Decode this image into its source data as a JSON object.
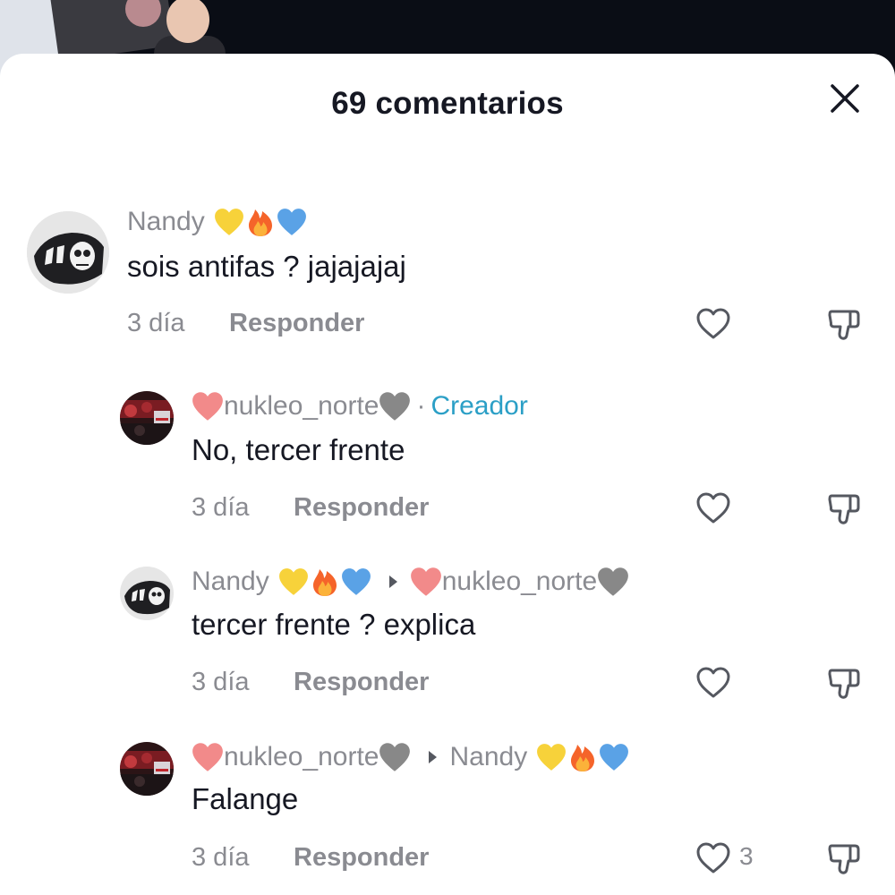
{
  "sheet": {
    "title": "69 comentarios"
  },
  "comments": [
    {
      "username": "Nandy",
      "emojis": [
        "yellow-heart",
        "fire",
        "blue-heart"
      ],
      "text": "sois antifas ? jajajajaj",
      "time": "3 día",
      "reply_label": "Responder"
    },
    {
      "username_prefix_emoji": "red-heart",
      "username": "nukleo_norte",
      "username_suffix_emoji": "grey-heart",
      "separator": "·",
      "badge": "Creador",
      "text": "No, tercer frente",
      "time": "3 día",
      "reply_label": "Responder"
    },
    {
      "username": "Nandy",
      "emojis": [
        "yellow-heart",
        "fire",
        "blue-heart"
      ],
      "reply_to_prefix_emoji": "red-heart",
      "reply_to": "nukleo_norte",
      "reply_to_suffix_emoji": "grey-heart",
      "text": "tercer frente ? explica",
      "time": "3 día",
      "reply_label": "Responder"
    },
    {
      "username_prefix_emoji": "red-heart",
      "username": "nukleo_norte",
      "username_suffix_emoji": "grey-heart",
      "reply_to": "Nandy",
      "reply_to_emojis": [
        "yellow-heart",
        "fire",
        "blue-heart"
      ],
      "text": "Falange",
      "time": "3 día",
      "reply_label": "Responder",
      "like_count": "3"
    }
  ],
  "colors": {
    "text_primary": "#161823",
    "text_secondary": "#8a8b91",
    "creator_badge": "#2b9fc6"
  }
}
